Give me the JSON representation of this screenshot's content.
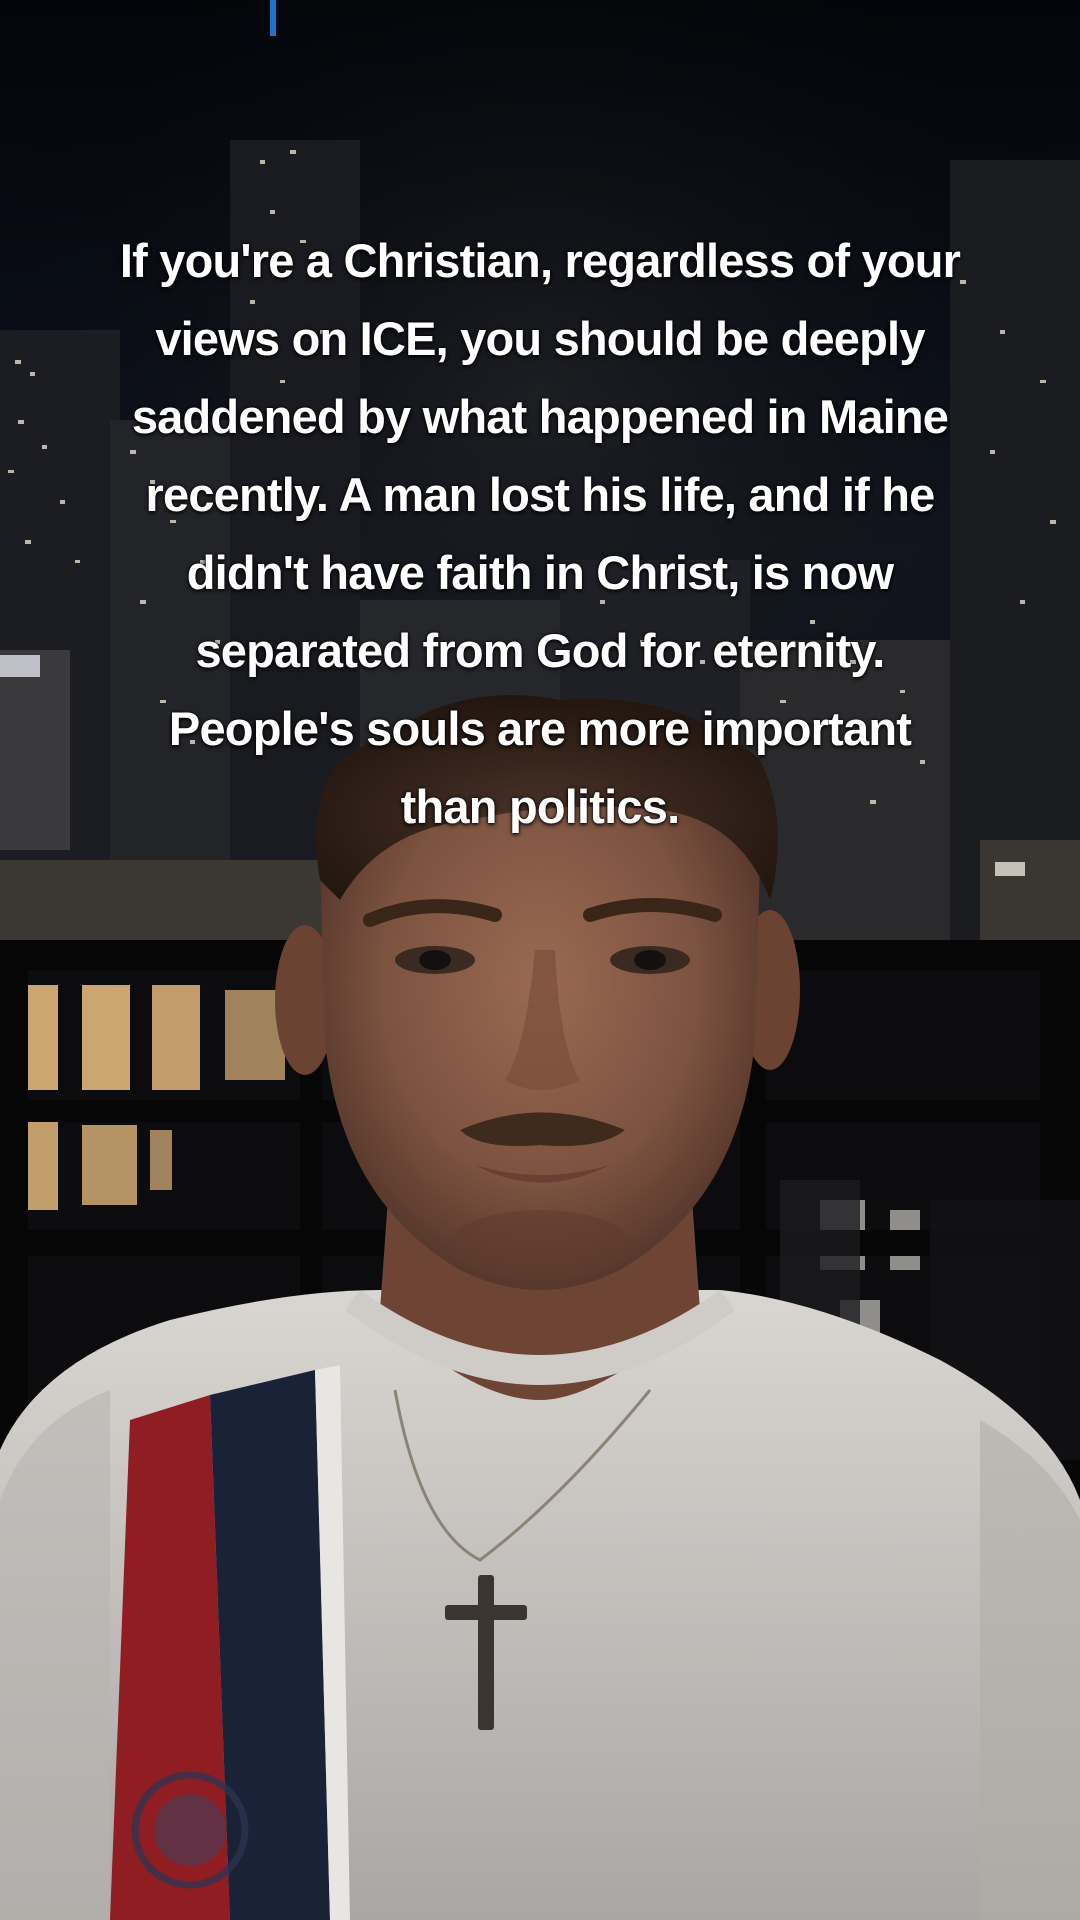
{
  "video": {
    "caption_lines": [
      "If you're a Christian, regardless of your",
      "views on ICE, you should be deeply",
      "saddened by what happened in Maine",
      "recently. A man lost his life, and if he",
      "didn't have faith in Christ, is now",
      "separated from God for eternity.",
      "People's souls are more important",
      "than politics."
    ]
  },
  "colors": {
    "caption_text": "#ffffff",
    "night_sky": "#05070c",
    "shirt": "#d9d6d2",
    "shirt_stripe_red": "#8f1d22",
    "shirt_stripe_navy": "#1a2237",
    "skin": "#8a5c47",
    "window_glow": "#e0b77a"
  },
  "icons": {
    "scene": "selfie-video-frame",
    "necklace": "cross-pendant-icon",
    "shirt_logo": "club-crest-icon"
  }
}
